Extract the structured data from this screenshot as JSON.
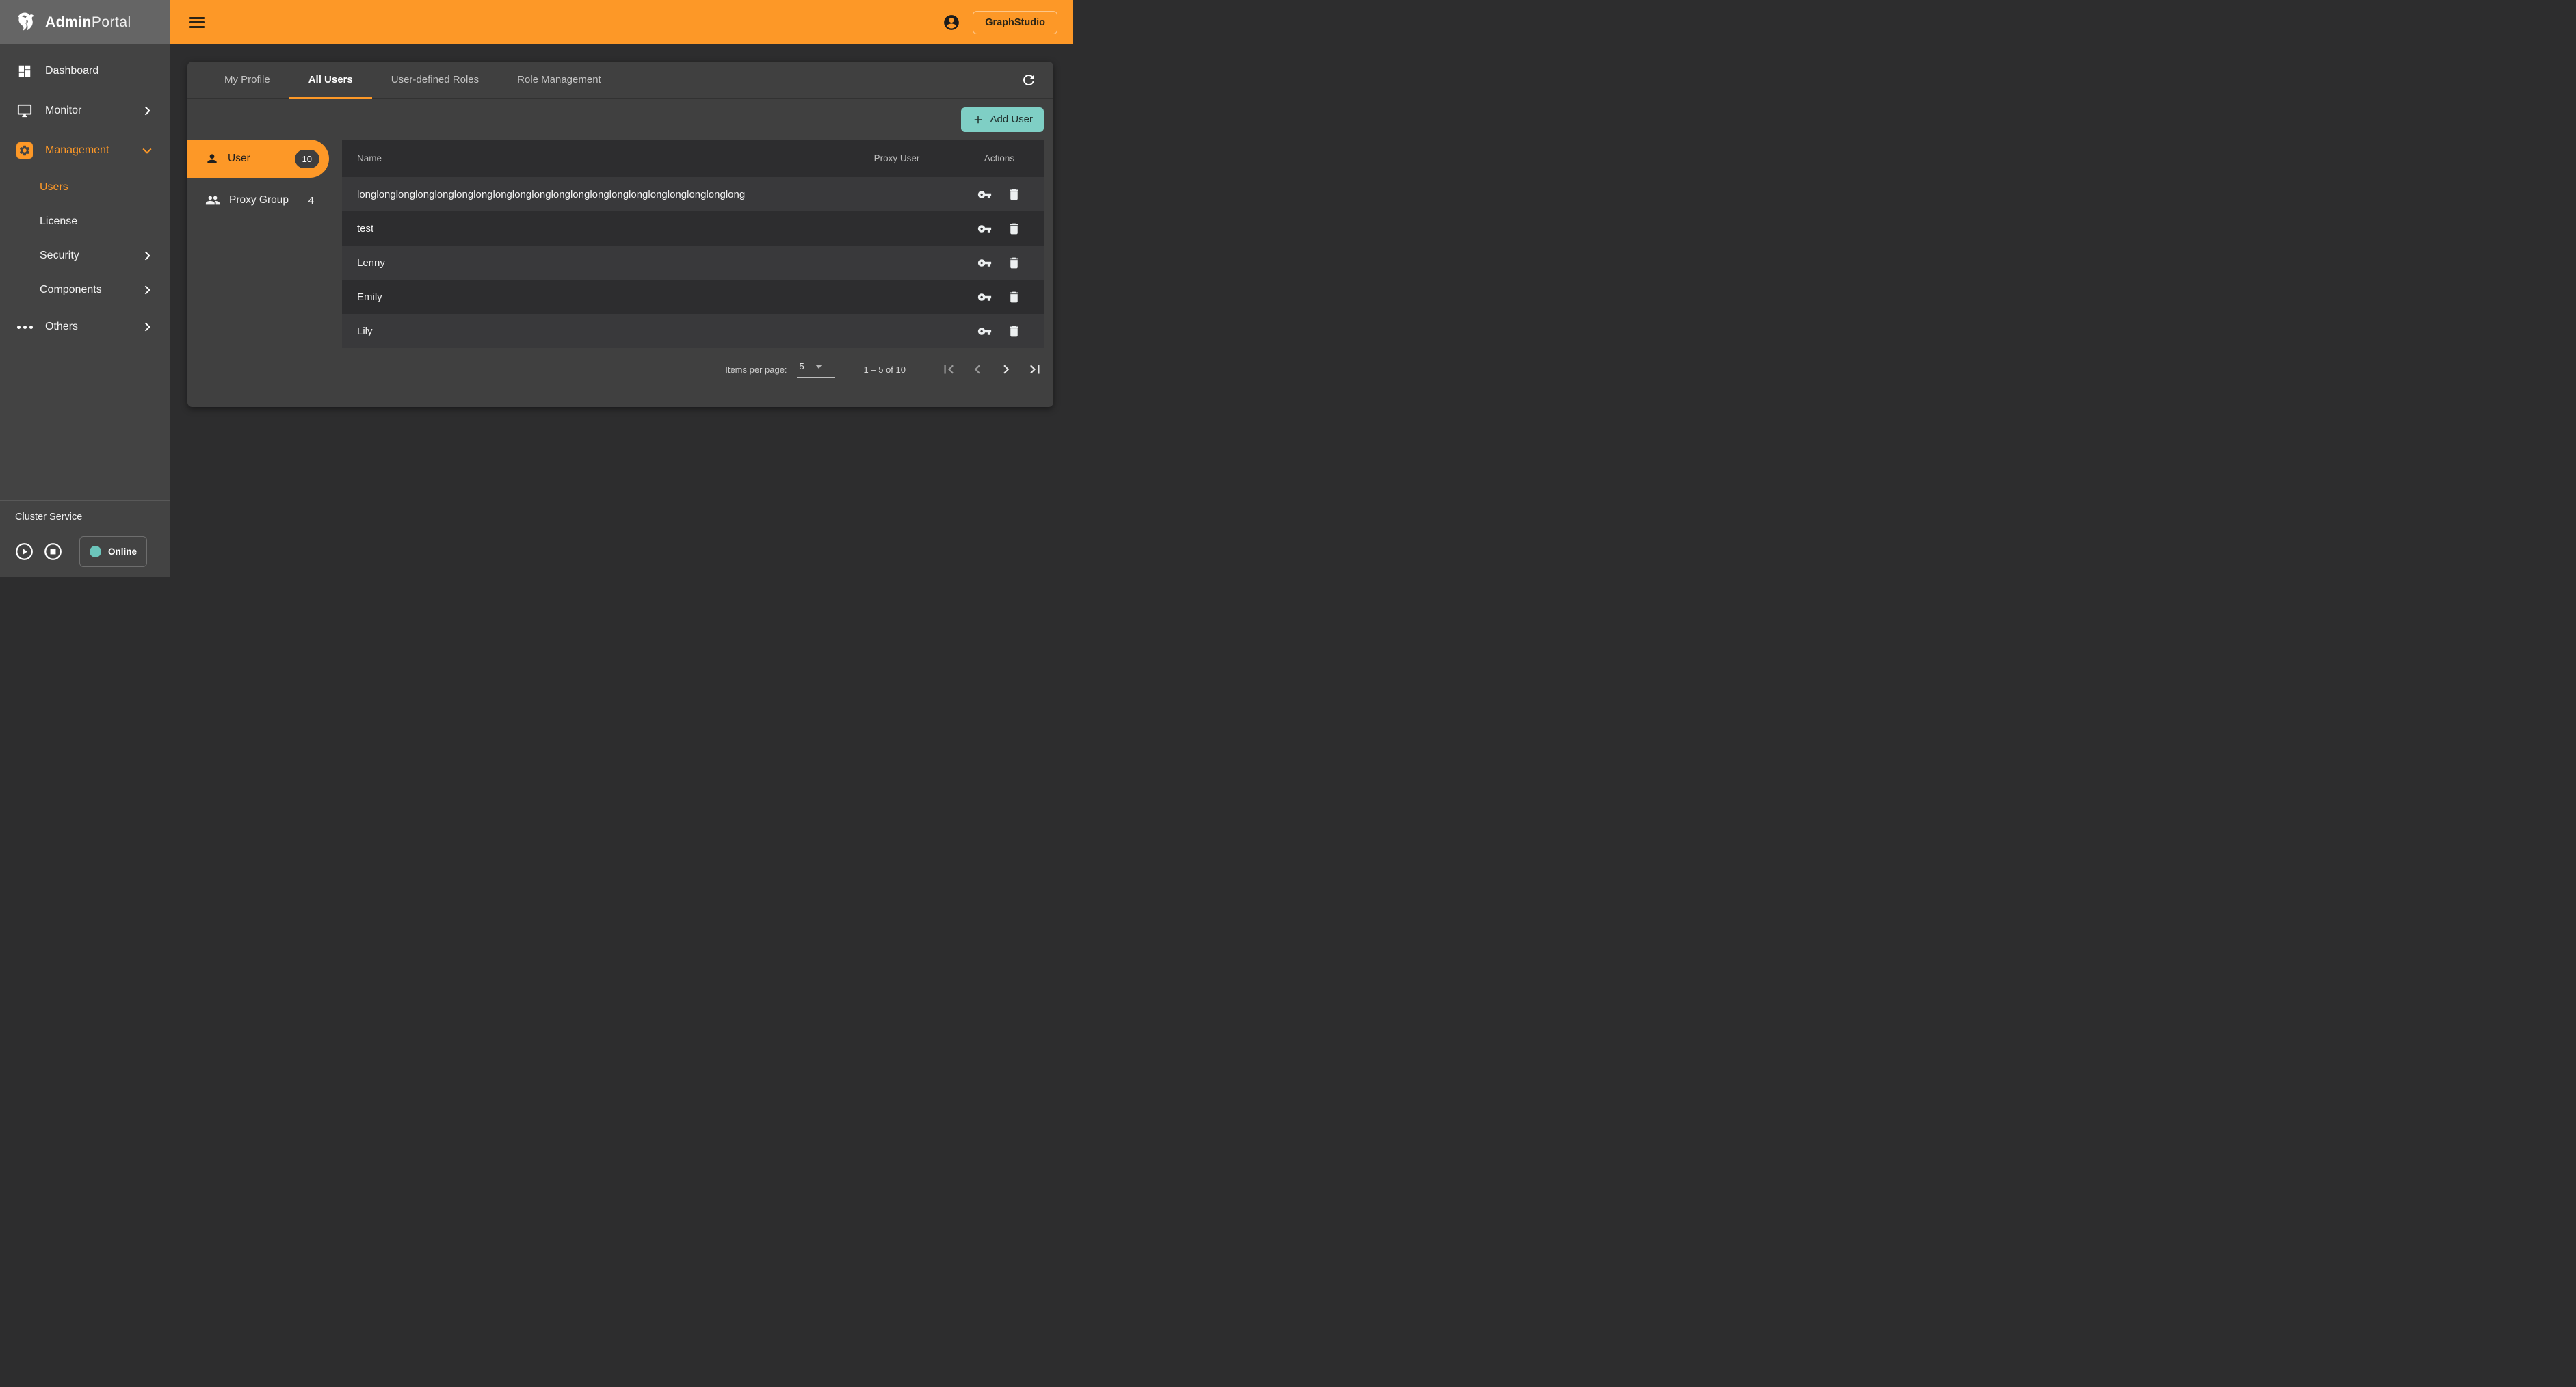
{
  "brand": {
    "bold": "Admin",
    "light": "Portal"
  },
  "topbar": {
    "graphstudio_label": "GraphStudio"
  },
  "sidebar": {
    "items": {
      "dashboard": "Dashboard",
      "monitor": "Monitor",
      "management": "Management",
      "users": "Users",
      "license": "License",
      "security": "Security",
      "components": "Components",
      "others": "Others"
    },
    "cluster": {
      "title": "Cluster Service",
      "status": "Online"
    }
  },
  "tabs": {
    "my_profile": "My Profile",
    "all_users": "All Users",
    "user_defined_roles": "User-defined Roles",
    "role_management": "Role Management"
  },
  "toolbar": {
    "add_user": "Add User"
  },
  "entity_list": {
    "user_label": "User",
    "user_count": "10",
    "proxy_group_label": "Proxy Group",
    "proxy_group_count": "4"
  },
  "table": {
    "col_name": "Name",
    "col_proxy_user": "Proxy User",
    "col_actions": "Actions",
    "rows": [
      {
        "name": "longlonglonglonglonglonglonglonglonglonglonglonglonglonglonglonglonglonglonglong"
      },
      {
        "name": "test"
      },
      {
        "name": "Lenny"
      },
      {
        "name": "Emily"
      },
      {
        "name": "Lily"
      }
    ]
  },
  "pagination": {
    "items_per_page_label": "Items per page:",
    "page_size": "5",
    "range_label": "1 – 5 of 10"
  },
  "icons": {
    "topbar": [
      "menu-icon",
      "account-circle-icon"
    ],
    "row_actions": [
      "key-icon",
      "delete-icon"
    ],
    "pager": [
      "first-page-icon",
      "chevron-left-icon",
      "chevron-right-icon",
      "last-page-icon"
    ]
  },
  "colors": {
    "accent_orange": "#fd9827",
    "teal_button": "#7fcfc5",
    "status_online_dot": "#6cc5bb",
    "sidebar_bg": "#434343",
    "card_bg": "#404040",
    "page_bg": "#2d2d2e"
  }
}
